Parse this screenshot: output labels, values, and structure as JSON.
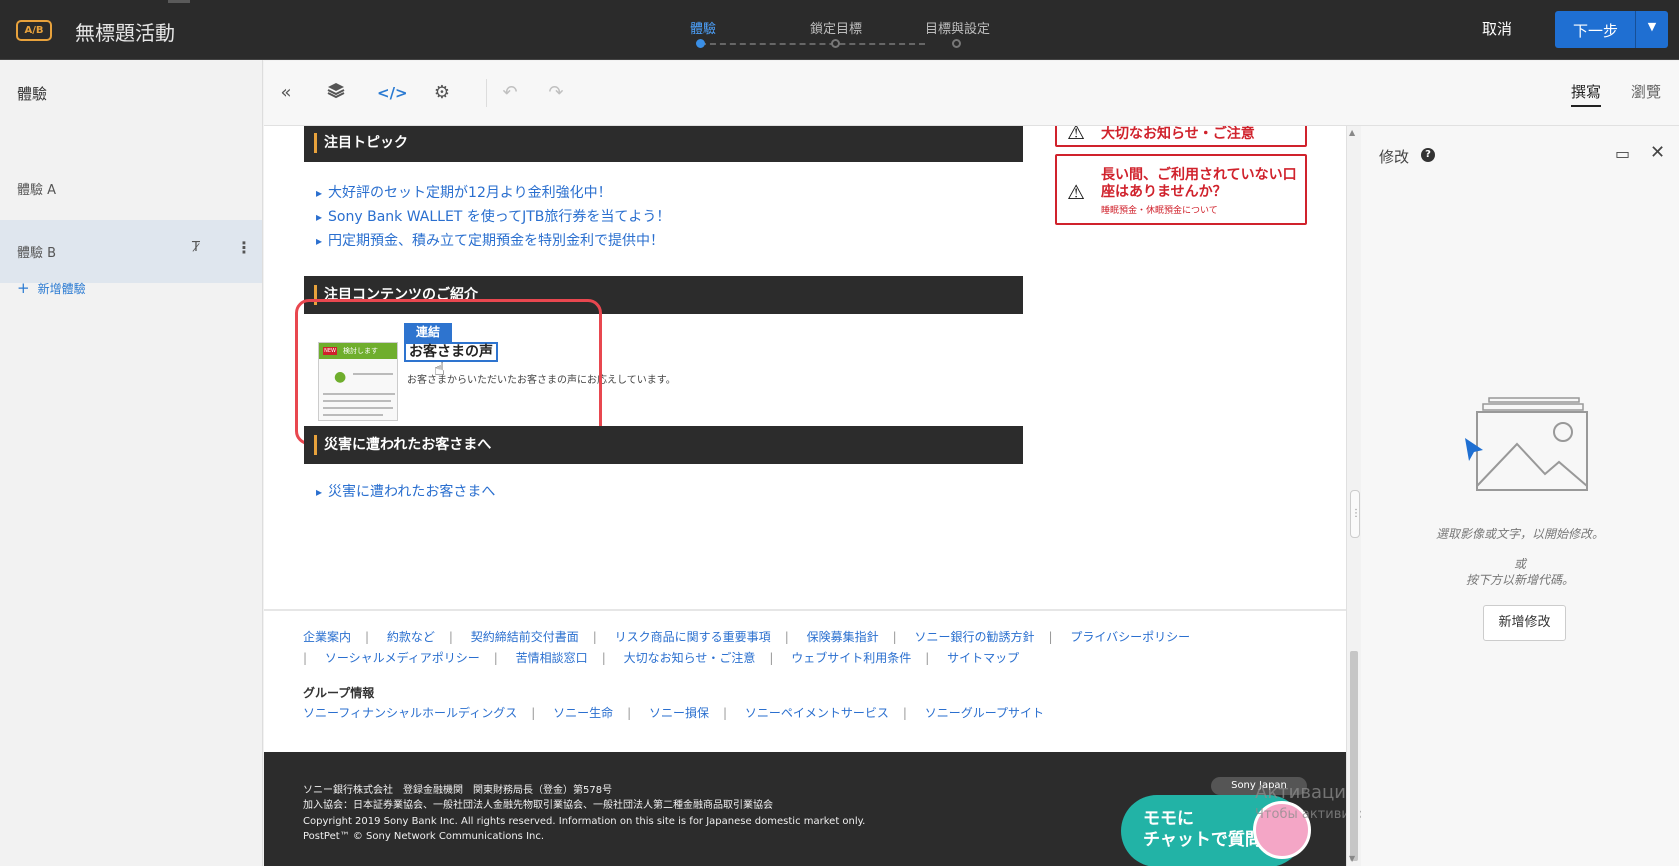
{
  "header": {
    "ab_badge": "A/B",
    "campaign_title": "無標題活動",
    "steps": [
      {
        "label": "體驗",
        "active": true
      },
      {
        "label": "鎖定目標",
        "active": false
      },
      {
        "label": "目標與設定",
        "active": false
      }
    ],
    "cancel_label": "取消",
    "next_label": "下一步"
  },
  "sidebar": {
    "heading": "體驗",
    "items": [
      {
        "label": "體驗 A",
        "active": false
      },
      {
        "label": "體驗 B",
        "active": true
      }
    ],
    "add_label": "新增體驗"
  },
  "toolbar": {
    "icons": [
      "collapse-left-icon",
      "layers-icon",
      "code-icon",
      "settings-icon",
      "undo-icon",
      "redo-icon"
    ],
    "mode_tabs": [
      {
        "label": "撰寫",
        "active": true
      },
      {
        "label": "瀏覽",
        "active": false
      }
    ]
  },
  "canvas": {
    "section_topics": "注目トピック",
    "topic_links": [
      "大好評のセット定期が12月より金利強化中！",
      "Sony Bank WALLET を使ってJTB旅行券を当てよう！",
      "円定期預金、積み立て定期預金を特別金利で提供中！"
    ],
    "notice_top": "大切なお知らせ・ご注意",
    "notice_main": "長い間、ご利用されていない口座はありませんか？",
    "notice_sub": "睡眠預金・休眠預金について",
    "section_content": "注目コンテンツのご紹介",
    "link_tag": "連結",
    "voice_title": "お客さまの声",
    "voice_desc": "お客さまからいただいたお客さまの声にお応えしています。",
    "thumb_label": "検討します",
    "section_disaster": "災害に遭われたお客さまへ",
    "disaster_link": "災害に遭われたお客さまへ",
    "footer_row1": [
      "企業案内",
      "約款など",
      "契約締結前交付書面",
      "リスク商品に関する重要事項",
      "保険募集指針",
      "ソニー銀行の勧誘方針",
      "プライバシーポリシー"
    ],
    "footer_row2": [
      "ソーシャルメディアポリシー",
      "苦情相談窓口",
      "大切なお知らせ・ご注意",
      "ウェブサイト利用条件",
      "サイトマップ"
    ],
    "group_title": "グループ情報",
    "footer_row3": [
      "ソニーフィナンシャルホールディングス",
      "ソニー生命",
      "ソニー損保",
      "ソニーペイメントサービス",
      "ソニーグループサイト"
    ],
    "dark_lines": [
      "ソニー銀行株式会社　登録金融機関　関東財務局長（登金）第578号",
      "加入協会：日本証券業協会、一般社団法人金融先物取引業協会、一般社団法人第二種金融商品取引業協会",
      "Copyright 2019 Sony Bank Inc. All rights reserved. Information on this site is for Japanese domestic market only.",
      "PostPet™ © Sony Network Communications Inc."
    ],
    "sony_pill": "Sony Japan",
    "chat_line1": "モモに",
    "chat_line2": "チャットで質問"
  },
  "watermark": {
    "line1": "Активация Windows",
    "line2": "Чтобы активировать Windows, перейдите в раздел"
  },
  "right_panel": {
    "title": "修改",
    "hint_line1": "選取影像或文字，以開始修改。",
    "hint_line2": "或",
    "hint_line3": "按下方以新增代碼。",
    "add_button": "新增修改"
  },
  "colors": {
    "primary_blue": "#1f6fd2",
    "accent_orange": "#e8a23c",
    "notice_red": "#d0222c",
    "highlight_red": "#e8474f",
    "chat_teal": "#22b3a6"
  }
}
